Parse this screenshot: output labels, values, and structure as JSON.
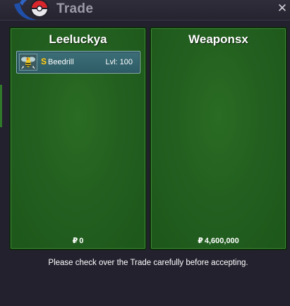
{
  "window": {
    "title": "Trade",
    "close_glyph": "✕"
  },
  "trade": {
    "left": {
      "trainer_name": "Leeluckya",
      "pokemon": [
        {
          "name": "Beedrill",
          "level_text": "Lvl: 100",
          "shiny_badge": "S",
          "sprite_icon": "beedrill-sprite-icon"
        }
      ],
      "currency_symbol": "₽",
      "money": "0"
    },
    "right": {
      "trainer_name": "Weaponsx",
      "pokemon": [],
      "currency_symbol": "₽",
      "money": "4,600,000"
    }
  },
  "footer": {
    "notice": "Please check over the Trade carefully before accepting."
  },
  "colors": {
    "panel_green": "#236020",
    "slot_teal": "#3d6f78",
    "window_bg": "#23212e",
    "shiny_gold": "#ffd21f"
  }
}
